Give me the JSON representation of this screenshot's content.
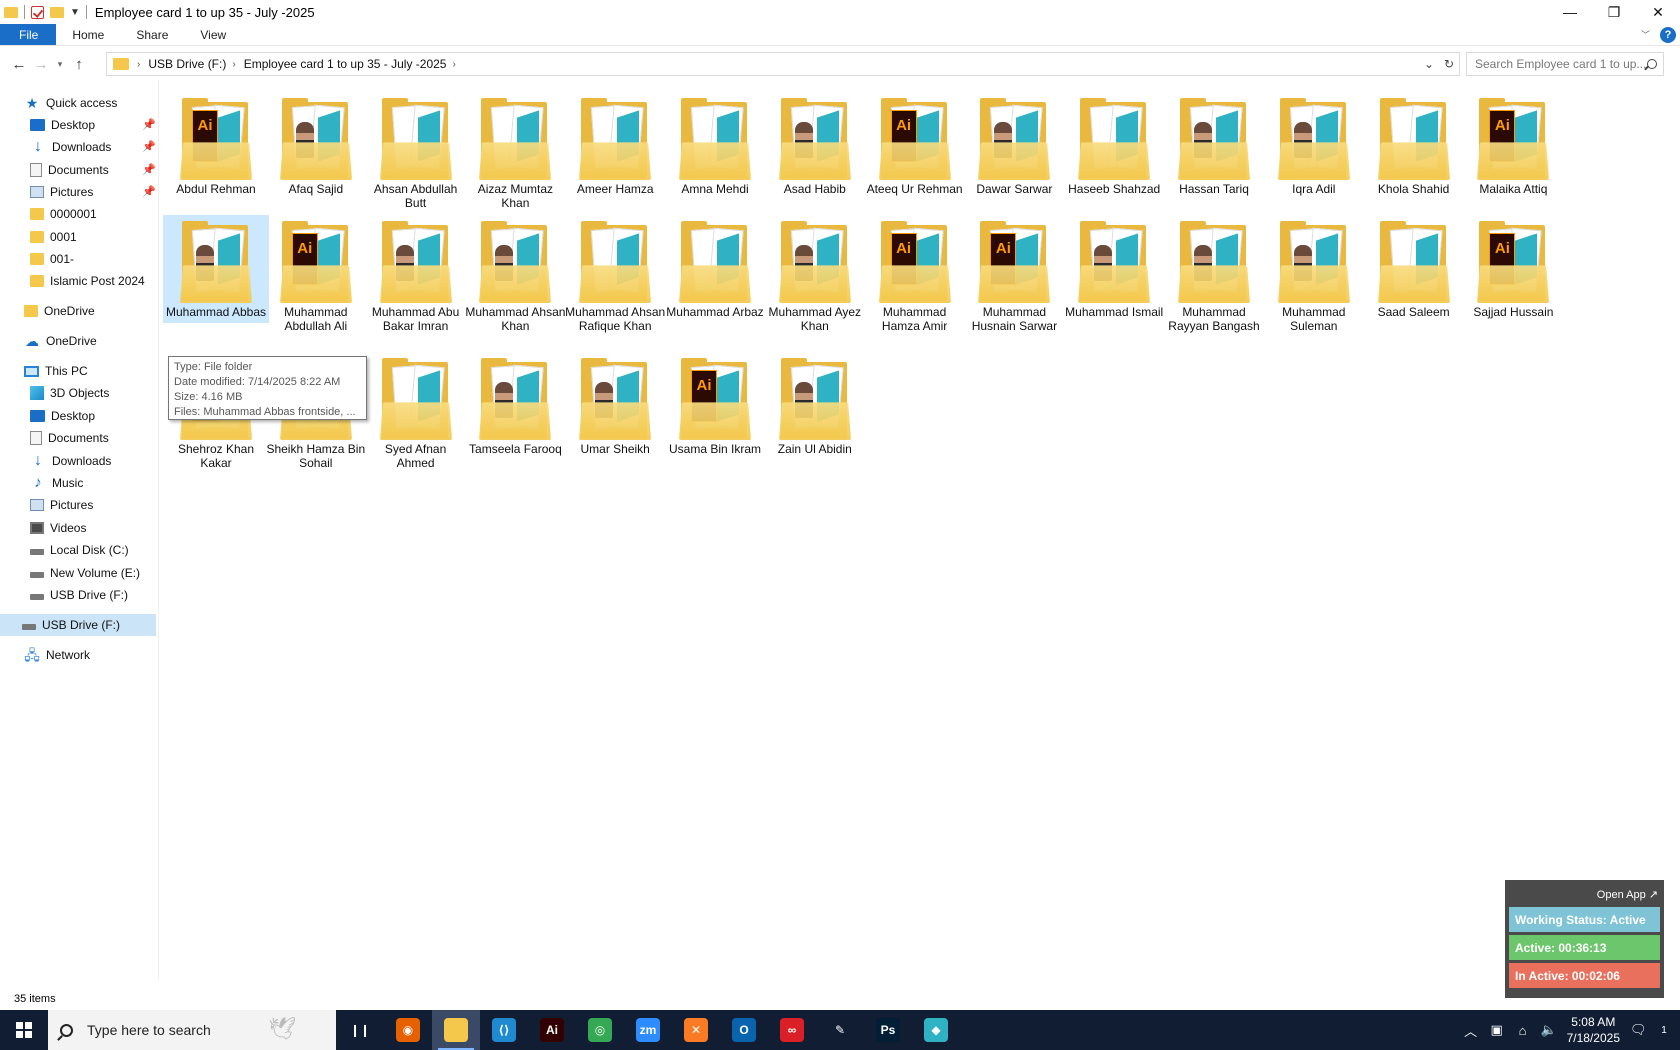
{
  "window": {
    "title": "Employee card 1 to up 35 - July -2025",
    "minimize": "—",
    "maximize": "❐",
    "close": "✕"
  },
  "ribbon": {
    "tabs": [
      "File",
      "Home",
      "Share",
      "View"
    ],
    "help": "?"
  },
  "address": {
    "crumbs": [
      "USB Drive (F:)",
      "Employee card 1 to up 35 - July -2025"
    ],
    "search_placeholder": "Search Employee card 1 to up..."
  },
  "sidebar": {
    "quick_access": "Quick access",
    "quick_items": [
      "Desktop",
      "Downloads",
      "Documents",
      "Pictures",
      "0000001",
      "0001",
      "001-",
      "Islamic Post 2024"
    ],
    "onedrive_personal": "OneDrive",
    "onedrive": "OneDrive",
    "this_pc": "This PC",
    "pc_items": [
      "3D Objects",
      "Desktop",
      "Documents",
      "Downloads",
      "Music",
      "Pictures",
      "Videos",
      "Local Disk (C:)",
      "New Volume (E:)",
      "USB Drive (F:)"
    ],
    "usb_drive": "USB Drive (F:)",
    "network": "Network"
  },
  "folders": [
    {
      "name": "Abdul Rehman",
      "thumb": "ai"
    },
    {
      "name": "Afaq Sajid",
      "thumb": "photo"
    },
    {
      "name": "Ahsan Abdullah Butt",
      "thumb": "card"
    },
    {
      "name": "Aizaz Mumtaz Khan",
      "thumb": "card"
    },
    {
      "name": "Ameer Hamza",
      "thumb": "card"
    },
    {
      "name": "Amna Mehdi",
      "thumb": "card"
    },
    {
      "name": "Asad Habib",
      "thumb": "photo"
    },
    {
      "name": "Ateeq Ur Rehman",
      "thumb": "ai"
    },
    {
      "name": "Dawar Sarwar",
      "thumb": "photo"
    },
    {
      "name": "Haseeb Shahzad",
      "thumb": "card"
    },
    {
      "name": "Hassan Tariq",
      "thumb": "photo"
    },
    {
      "name": "Iqra Adil",
      "thumb": "photo"
    },
    {
      "name": "Khola Shahid",
      "thumb": "card"
    },
    {
      "name": "Malaika Attiq",
      "thumb": "ai"
    },
    {
      "name": "Muhammad Abbas",
      "thumb": "photo"
    },
    {
      "name": "Muhammad Abdullah Ali",
      "thumb": "ai"
    },
    {
      "name": "Muhammad Abu Bakar Imran",
      "thumb": "photo"
    },
    {
      "name": "Muhammad Ahsan Khan",
      "thumb": "photo"
    },
    {
      "name": "Muhammad Ahsan Rafique Khan",
      "thumb": "card"
    },
    {
      "name": "Muhammad Arbaz",
      "thumb": "card"
    },
    {
      "name": "Muhammad Ayez Khan",
      "thumb": "photo"
    },
    {
      "name": "Muhammad Hamza Amir",
      "thumb": "ai"
    },
    {
      "name": "Muhammad Husnain Sarwar",
      "thumb": "ai"
    },
    {
      "name": "Muhammad Ismail",
      "thumb": "photo"
    },
    {
      "name": "Muhammad Rayyan Bangash",
      "thumb": "photo"
    },
    {
      "name": "Muhammad Suleman",
      "thumb": "photo"
    },
    {
      "name": "Saad Saleem",
      "thumb": "card"
    },
    {
      "name": "Sajjad Hussain",
      "thumb": "ai"
    },
    {
      "name": "Shehroz Khan Kakar",
      "thumb": "ai"
    },
    {
      "name": "Sheikh Hamza Bin Sohail",
      "thumb": "photo"
    },
    {
      "name": "Syed Afnan Ahmed",
      "thumb": "card"
    },
    {
      "name": "Tamseela Farooq",
      "thumb": "photo"
    },
    {
      "name": "Umar Sheikh",
      "thumb": "photo"
    },
    {
      "name": "Usama Bin Ikram",
      "thumb": "ai"
    },
    {
      "name": "Zain Ul Abidin",
      "thumb": "photo"
    }
  ],
  "tooltip": {
    "type": "Type: File folder",
    "date": "Date modified: 7/14/2025 8:22 AM",
    "size": "Size: 4.16 MB",
    "files": "Files: Muhammad Abbas  frontside, ..."
  },
  "status": {
    "items": "35 items"
  },
  "widget": {
    "open_app": "Open App ↗",
    "working": "Working Status: Active",
    "active": "Active: 00:36:13",
    "inactive": "In Active: 00:02:06"
  },
  "taskbar": {
    "search_placeholder": "Type here to search",
    "apps": [
      {
        "name": "task-view-icon",
        "label": "❙❙",
        "color": "#101d33"
      },
      {
        "name": "firefox-icon",
        "label": "◉",
        "color": "#e66000"
      },
      {
        "name": "file-explorer-icon",
        "label": "",
        "color": "#f3c84b"
      },
      {
        "name": "vscode-icon",
        "label": "⟨⟩",
        "color": "#1f8ad2"
      },
      {
        "name": "illustrator-icon",
        "label": "Ai",
        "color": "#330000"
      },
      {
        "name": "chrome-icon",
        "label": "◎",
        "color": "#34a853"
      },
      {
        "name": "zoom-icon",
        "label": "zm",
        "color": "#2d8cff"
      },
      {
        "name": "xampp-icon",
        "label": "✕",
        "color": "#fb7a24"
      },
      {
        "name": "outlook-icon",
        "label": "O",
        "color": "#0a64ad"
      },
      {
        "name": "creative-cloud-icon",
        "label": "∞",
        "color": "#da1f26"
      },
      {
        "name": "pen-tool-icon",
        "label": "✎",
        "color": "#101d33"
      },
      {
        "name": "photoshop-icon",
        "label": "Ps",
        "color": "#001e36"
      },
      {
        "name": "tracker-app-icon",
        "label": "◆",
        "color": "#2fb3c4"
      }
    ],
    "time": "5:08 AM",
    "date": "7/18/2025",
    "notifications": "1"
  }
}
